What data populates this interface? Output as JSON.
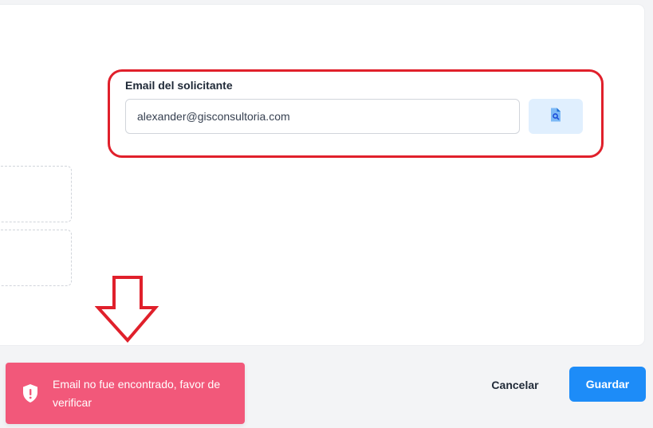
{
  "form": {
    "email_label": "Email del solicitante",
    "email_value": "alexander@gisconsultoria.com",
    "search_icon": "document-search-icon"
  },
  "toast": {
    "message": "Email no fue encontrado, favor de verificar",
    "icon": "shield-alert-icon",
    "color": "#f2587a"
  },
  "footer": {
    "cancel_label": "Cancelar",
    "save_label": "Guardar"
  },
  "colors": {
    "primary": "#1d8cf8",
    "annotation": "#e0202b",
    "search_button_bg": "#e0effe"
  }
}
